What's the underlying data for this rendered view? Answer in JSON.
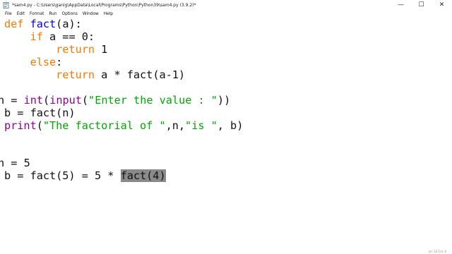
{
  "window": {
    "title": "*sam4.py - C:\\Users\\ganig\\AppData\\Local\\Programs\\Python\\Python39\\sam4.py (3.9.2)*",
    "minimize_glyph": "—",
    "maximize_glyph": "☐",
    "close_glyph": "✕"
  },
  "menu": [
    {
      "label": "File"
    },
    {
      "label": "Edit"
    },
    {
      "label": "Format"
    },
    {
      "label": "Run"
    },
    {
      "label": "Options"
    },
    {
      "label": "Window"
    },
    {
      "label": "Help"
    }
  ],
  "code": {
    "line1": {
      "kw": "def",
      "sp": " ",
      "name": "fact",
      "rest": "(a):"
    },
    "line2": {
      "indent": "    ",
      "kw": "if",
      "rest": " a == 0:"
    },
    "line3": {
      "indent": "        ",
      "kw": "return",
      "rest": " 1"
    },
    "line4": {
      "indent": "    ",
      "kw": "else",
      "rest": ":"
    },
    "line5": {
      "indent": "        ",
      "kw": "return",
      "rest": " a * fact(a-1)"
    },
    "line6": {
      "pre": "n = ",
      "bi1": "int",
      "p1": "(",
      "bi2": "input",
      "p2": "(",
      "str": "\"Enter the value : \"",
      "post": "))"
    },
    "line7": {
      "text": "b = fact(n)"
    },
    "line8": {
      "bi": "print",
      "p1": "(",
      "s1": "\"The factorial of \"",
      "mid": ",n,",
      "s2": "\"is \"",
      "post": ", b)"
    },
    "line9": {
      "text": "n = 5"
    },
    "line10": {
      "pre": "b = fact(5) = 5 * ",
      "hl": "fact(4)"
    }
  },
  "status": {
    "text": "Ln: 13  Col: 0"
  },
  "colors": {
    "keyword": "#ff7700",
    "builtin": "#900090",
    "string": "#00aa00",
    "definition": "#0000ff",
    "selection": "#8a8a8a"
  },
  "icons": {
    "app": "python-file-icon"
  }
}
